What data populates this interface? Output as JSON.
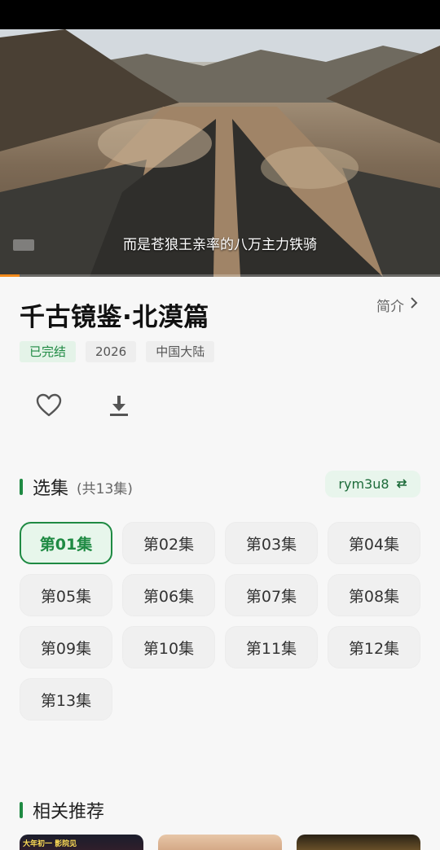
{
  "player": {
    "subtitle": "而是苍狼王亲率的八万主力铁骑",
    "progress_fraction": 0.045
  },
  "show": {
    "title": "千古镜鉴·北漠篇",
    "intro_label": "简介",
    "tags": [
      {
        "label": "已完结",
        "style": "green"
      },
      {
        "label": "2026",
        "style": "gray"
      },
      {
        "label": "中国大陆",
        "style": "gray"
      }
    ]
  },
  "actions": {
    "favorite_icon": "heart-outline-icon",
    "download_icon": "download-icon"
  },
  "episodes_section": {
    "title": "选集",
    "count_label": "(共13集)",
    "source_label": "rym3u8",
    "active_index": 0,
    "episodes": [
      "第01集",
      "第02集",
      "第03集",
      "第04集",
      "第05集",
      "第06集",
      "第07集",
      "第08集",
      "第09集",
      "第10集",
      "第11集",
      "第12集",
      "第13集"
    ]
  },
  "recommend_section": {
    "title": "相关推荐",
    "first_card_text": "大年初一 影院见"
  },
  "colors": {
    "accent": "#1f8a43",
    "accent_bg": "#e7f6eb",
    "progress": "#f28a1b"
  }
}
